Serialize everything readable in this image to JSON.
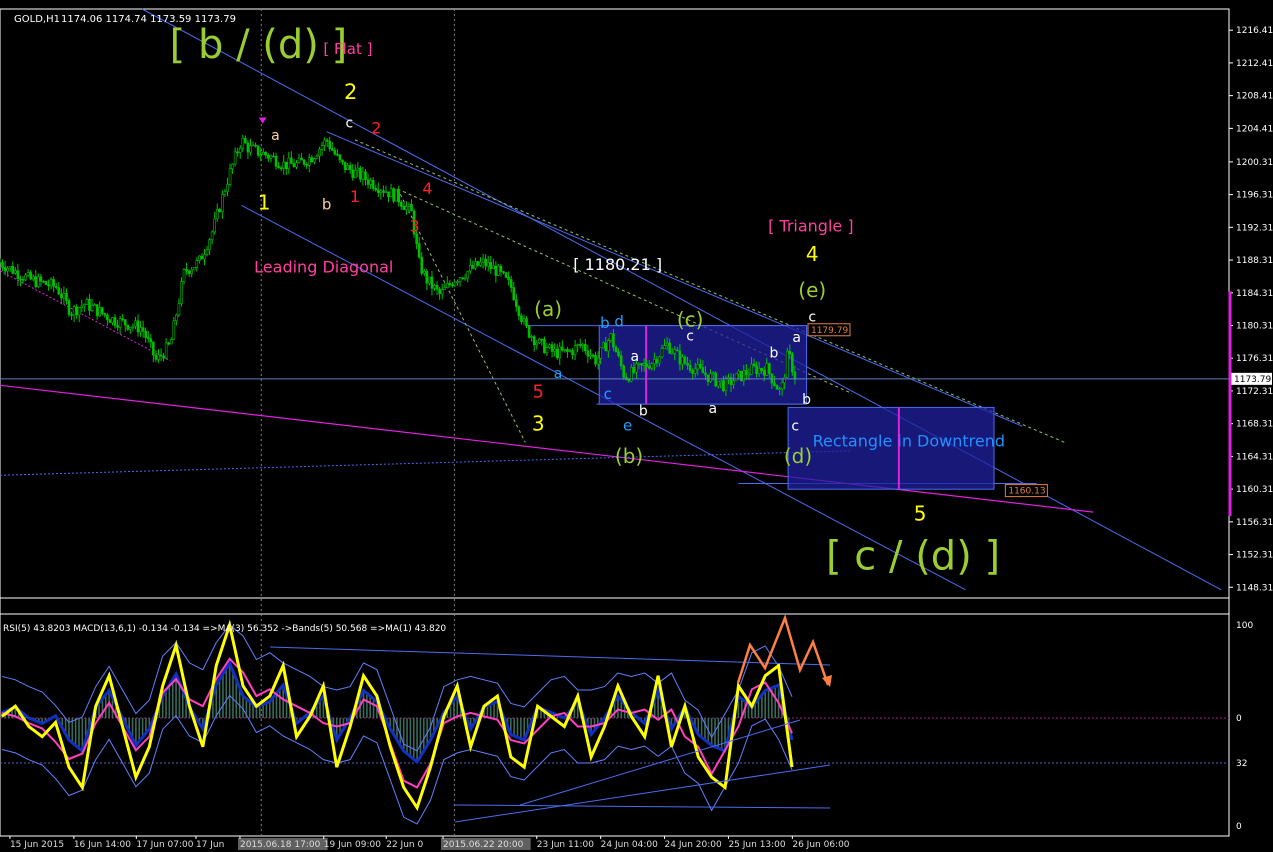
{
  "header": {
    "symbol": "GOLD,H1",
    "ohlc": "1174.06 1174.74 1173.59 1173.79"
  },
  "colors": {
    "background": "#000000",
    "bull": "#00c000",
    "bear": "#00c000",
    "channel": "#4a6cf0",
    "magenta": "#e020e0",
    "yellow": "#ffff00",
    "olive": "#9acd32",
    "white": "#ffffff",
    "orange": "#ff8040",
    "rect": "#2020a0"
  },
  "chart_data": [
    {
      "type": "candlestick",
      "title": "",
      "ylim": [
        1147,
        1219
      ],
      "y_ticks": [
        1216.41,
        1212.41,
        1208.41,
        1204.41,
        1200.31,
        1196.31,
        1192.31,
        1188.31,
        1184.31,
        1180.31,
        1176.31,
        1172.31,
        1168.31,
        1164.31,
        1160.31,
        1156.31,
        1152.31,
        1148.31
      ],
      "x_labels": [
        "15 Jun 2015",
        "16 Jun 14:00",
        "17 Jun 07:00",
        "17 Jun",
        "2015.06.18 17:00",
        "19 Jun 09:00",
        "22 Jun 0",
        "2015.06.22 20:00",
        "23 Jun 11:00",
        "24 Jun 04:00",
        "24 Jun 20:00",
        "25 Jun 13:00",
        "26 Jun 06:00"
      ],
      "x_label_positions": [
        0.7,
        5.2,
        9.6,
        13.8,
        16.9,
        22.8,
        27.2,
        31.2,
        37.8,
        42.3,
        46.8,
        51.3,
        55.8
      ],
      "price_path": [
        [
          0,
          1188
        ],
        [
          2,
          1186
        ],
        [
          4,
          1185
        ],
        [
          5,
          1182
        ],
        [
          6,
          1183
        ],
        [
          8,
          1181
        ],
        [
          10,
          1180
        ],
        [
          11,
          1176
        ],
        [
          12,
          1178
        ],
        [
          13,
          1187
        ],
        [
          14,
          1188
        ],
        [
          15,
          1192
        ],
        [
          16,
          1198
        ],
        [
          17,
          1203
        ],
        [
          17.5,
          1202
        ],
        [
          19,
          1201
        ],
        [
          20,
          1200
        ],
        [
          21,
          1200
        ],
        [
          22,
          1201
        ],
        [
          23,
          1203
        ],
        [
          24,
          1200
        ],
        [
          25,
          1199
        ],
        [
          26,
          1198
        ],
        [
          27,
          1197
        ],
        [
          28,
          1196
        ],
        [
          29,
          1194
        ],
        [
          29.5,
          1188
        ],
        [
          30,
          1186
        ],
        [
          31,
          1184
        ],
        [
          32,
          1186
        ],
        [
          33,
          1187
        ],
        [
          34,
          1188
        ],
        [
          35,
          1187
        ],
        [
          36,
          1185
        ],
        [
          37,
          1180
        ],
        [
          38,
          1178
        ],
        [
          39,
          1177
        ],
        [
          40,
          1177
        ],
        [
          41,
          1178
        ],
        [
          42,
          1176
        ],
        [
          43,
          1179
        ],
        [
          44,
          1174
        ],
        [
          45,
          1175
        ],
        [
          46,
          1176
        ],
        [
          47,
          1178
        ],
        [
          48,
          1176
        ],
        [
          49,
          1175
        ],
        [
          50,
          1174
        ],
        [
          51,
          1173
        ],
        [
          52,
          1174
        ],
        [
          53,
          1175
        ],
        [
          54,
          1175
        ],
        [
          55,
          1172
        ],
        [
          55.5,
          1177
        ],
        [
          56,
          1174
        ]
      ],
      "current_price": 1173.79,
      "price_labels": [
        {
          "text": "1179.79",
          "price": 1179.79
        },
        {
          "text": "1160.13",
          "price": 1160.13
        }
      ],
      "annotations": [
        {
          "text": "[ b / (d) ]",
          "color": "#9acd32",
          "t": 18.2,
          "p": 1213,
          "size": 40
        },
        {
          "text": "[ Flat ]",
          "color": "#ff40a0",
          "t": 24.5,
          "p": 1213.5,
          "size": 15
        },
        {
          "text": "2",
          "color": "#ffff00",
          "t": 24.7,
          "p": 1208,
          "size": 21
        },
        {
          "text": "c",
          "color": "#ffffff",
          "t": 24.6,
          "p": 1204.5,
          "size": 14
        },
        {
          "text": "2",
          "color": "#ff2020",
          "t": 26.5,
          "p": 1203.8,
          "size": 16
        },
        {
          "text": "a",
          "color": "#ffd0a0",
          "t": 19.4,
          "p": 1203,
          "size": 14
        },
        {
          "text": "1",
          "color": "#ffff00",
          "t": 18.6,
          "p": 1194.5,
          "size": 20
        },
        {
          "text": "b",
          "color": "#ffd0a0",
          "t": 23,
          "p": 1194.5,
          "size": 15
        },
        {
          "text": "1",
          "color": "#ff2020",
          "t": 25,
          "p": 1195.4,
          "size": 16
        },
        {
          "text": "4",
          "color": "#ff2020",
          "t": 30.1,
          "p": 1196.4,
          "size": 16
        },
        {
          "text": "3",
          "color": "#ff2020",
          "t": 29.2,
          "p": 1191.8,
          "size": 16
        },
        {
          "text": "Leading Diagonal",
          "color": "#ff40a0",
          "t": 22.8,
          "p": 1186.8,
          "size": 16
        },
        {
          "text": "[ 1180.21 ]",
          "color": "#ffffff",
          "t": 43.5,
          "p": 1187.1,
          "size": 16
        },
        {
          "text": "(a)",
          "color": "#9acd32",
          "t": 38.6,
          "p": 1181.5,
          "size": 20
        },
        {
          "text": "(c)",
          "color": "#9acd32",
          "t": 48.6,
          "p": 1180.2,
          "size": 20
        },
        {
          "text": "(b)",
          "color": "#9acd32",
          "t": 44.3,
          "p": 1163.5,
          "size": 20
        },
        {
          "text": "(d)",
          "color": "#9acd32",
          "t": 56.2,
          "p": 1163.5,
          "size": 20
        },
        {
          "text": "(e)",
          "color": "#9acd32",
          "t": 57.2,
          "p": 1183.8,
          "size": 20
        },
        {
          "text": "[ Triangle ]",
          "color": "#ff40a0",
          "t": 57.1,
          "p": 1191.8,
          "size": 16
        },
        {
          "text": "4",
          "color": "#ffff00",
          "t": 57.2,
          "p": 1188.2,
          "size": 20
        },
        {
          "text": "c",
          "color": "#ffffff",
          "t": 57.2,
          "p": 1180.8,
          "size": 14
        },
        {
          "text": "a",
          "color": "#ffffff",
          "t": 56.1,
          "p": 1178.3,
          "size": 14
        },
        {
          "text": "b",
          "color": "#ffffff",
          "t": 56.8,
          "p": 1170.7,
          "size": 14
        },
        {
          "text": "c",
          "color": "#ffffff",
          "t": 56,
          "p": 1167.5,
          "size": 14
        },
        {
          "text": "5",
          "color": "#ff2020",
          "t": 37.9,
          "p": 1171.5,
          "size": 18
        },
        {
          "text": "3",
          "color": "#ffff00",
          "t": 37.9,
          "p": 1167.5,
          "size": 20
        },
        {
          "text": "b",
          "color": "#20a0ff",
          "t": 42.6,
          "p": 1180,
          "size": 15
        },
        {
          "text": "d",
          "color": "#20a0ff",
          "t": 43.6,
          "p": 1180.2,
          "size": 15
        },
        {
          "text": "c",
          "color": "#20a0ff",
          "t": 42.8,
          "p": 1171.3,
          "size": 15
        },
        {
          "text": "e",
          "color": "#20a0ff",
          "t": 44.2,
          "p": 1167.5,
          "size": 15
        },
        {
          "text": "a",
          "color": "#20a0ff",
          "t": 39.3,
          "p": 1173.9,
          "size": 14
        },
        {
          "text": "a",
          "color": "#ffffff",
          "t": 44.7,
          "p": 1176,
          "size": 14
        },
        {
          "text": "b",
          "color": "#ffffff",
          "t": 45.3,
          "p": 1169.3,
          "size": 14
        },
        {
          "text": "c",
          "color": "#ffffff",
          "t": 48.6,
          "p": 1178.5,
          "size": 14
        },
        {
          "text": "a",
          "color": "#ffffff",
          "t": 50.2,
          "p": 1169.6,
          "size": 14
        },
        {
          "text": "b",
          "color": "#ffffff",
          "t": 54.5,
          "p": 1176.4,
          "size": 14
        },
        {
          "text": "Rectangle in Downtrend",
          "color": "#2090ff",
          "t": 64,
          "p": 1165.5,
          "size": 16
        },
        {
          "text": "5",
          "color": "#ffff00",
          "t": 64.8,
          "p": 1156.5,
          "size": 20
        },
        {
          "text": "[ c / (d) ]",
          "color": "#9acd32",
          "t": 64.3,
          "p": 1150.5,
          "size": 40
        }
      ]
    },
    {
      "type": "line",
      "title": "RSI(5) 43.8203  MACD(13,6,1) -0.134 -0.134  =>MA(3) 56.352  ->Bands(5) 50.568  =>MA(1) 43.820",
      "ylim": [
        0,
        100
      ],
      "y_ticks": [
        100,
        0,
        32,
        0
      ],
      "series": [
        {
          "name": "RSI(5)",
          "color": "#ffff00",
          "values": [
            55,
            60,
            50,
            45,
            52,
            30,
            20,
            60,
            75,
            50,
            25,
            40,
            70,
            90,
            60,
            40,
            80,
            100,
            70,
            60,
            65,
            80,
            45,
            55,
            70,
            30,
            50,
            75,
            65,
            40,
            20,
            10,
            30,
            55,
            70,
            40,
            60,
            65,
            35,
            30,
            60,
            55,
            50,
            65,
            35,
            50,
            70,
            55,
            45,
            75,
            40,
            60,
            35,
            25,
            20,
            70,
            60,
            75,
            80,
            30
          ]
        }
      ]
    }
  ]
}
